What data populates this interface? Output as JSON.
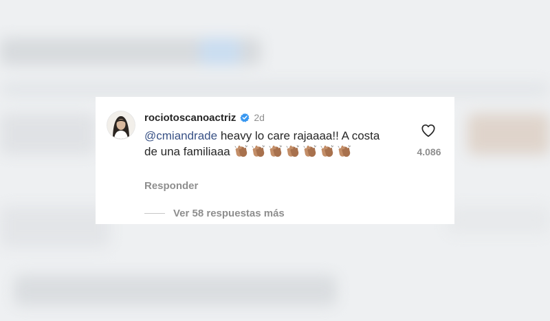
{
  "comment": {
    "username": "rociotoscanoactriz",
    "time": "2d",
    "mention": "@cmiandrade",
    "text": "heavy lo care rajaaaa!! A costa de una familiaaa",
    "emoji_icon": "clapping-hands-icon",
    "emoji_count": 7,
    "reply_label": "Responder",
    "like_count": "4.086",
    "view_replies_label": "Ver 58 respuestas más"
  },
  "colors": {
    "username": "#262626",
    "mention": "#385185",
    "secondary": "#8e8e8e",
    "verified_badge": "#3897f0",
    "background_blur": "#eef0f2"
  }
}
